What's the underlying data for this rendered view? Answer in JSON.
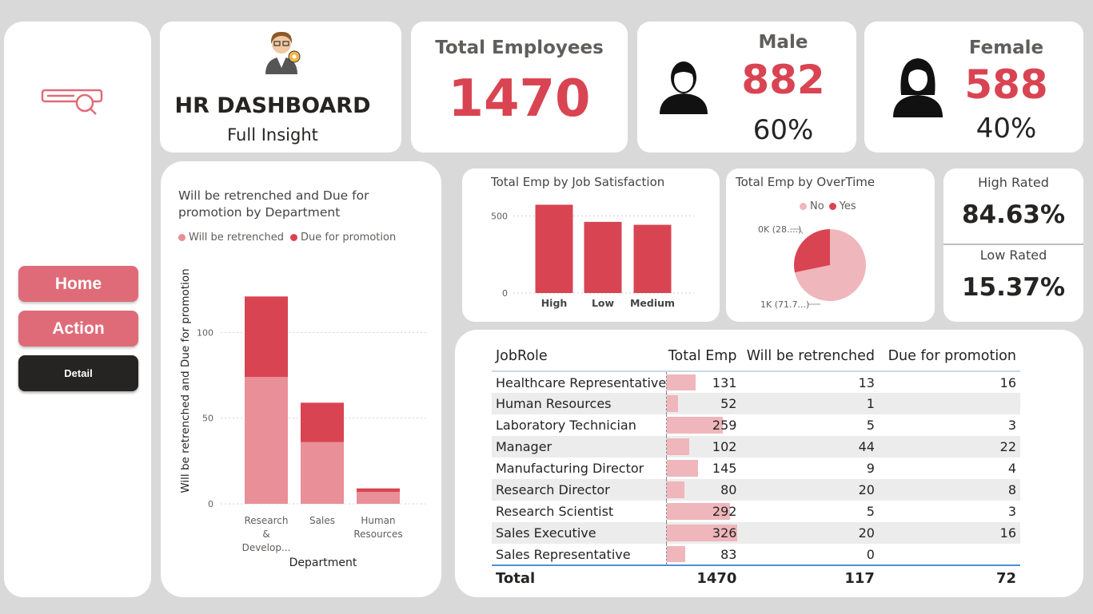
{
  "nav": {
    "home": "Home",
    "action": "Action",
    "detail": "Detail"
  },
  "header": {
    "title": "HR DASHBOARD",
    "subtitle": "Full Insight"
  },
  "kpis": {
    "total_label": "Total Employees",
    "total_value": "1470",
    "male_label": "Male",
    "male_value": "882",
    "male_pct": "60%",
    "female_label": "Female",
    "female_value": "588",
    "female_pct": "40%",
    "high_label": "High Rated",
    "high_value": "84.63%",
    "low_label": "Low Rated",
    "low_value": "15.37%"
  },
  "colors": {
    "accent": "#d94452",
    "light_accent": "#e88f98",
    "pie_light": "#efb6bb"
  },
  "dept_chart": {
    "title": "Will be retrenched and Due for promotion by Department",
    "legend": [
      "Will be retrenched",
      "Due for promotion"
    ],
    "ylabel": "Will be retrenched and Due for promotion",
    "xlabel": "Department"
  },
  "job_sat_chart": {
    "title": "Total Emp by Job Satisfaction"
  },
  "overtime_chart": {
    "title": "Total Emp by OverTime",
    "legend": [
      "No",
      "Yes"
    ],
    "label_yes": "0K (28....)",
    "label_no": "1K (71.7...)"
  },
  "chart_data": [
    {
      "type": "bar",
      "stacked": true,
      "categories": [
        "Research & Develop...",
        "Sales",
        "Human Resources"
      ],
      "series": [
        {
          "name": "Will be retrenched",
          "values": [
            74,
            36,
            7
          ],
          "color": "#e88f98"
        },
        {
          "name": "Due for promotion",
          "values": [
            47,
            23,
            2
          ],
          "color": "#d94452"
        }
      ],
      "yticks": [
        0,
        50,
        100
      ],
      "ylim": [
        0,
        130
      ]
    },
    {
      "type": "bar",
      "categories": [
        "High",
        "Low",
        "Medium"
      ],
      "values": [
        572,
        461,
        442
      ],
      "yticks": [
        0,
        500
      ],
      "ylim": [
        0,
        600
      ],
      "color": "#d94452"
    },
    {
      "type": "pie",
      "labels": [
        "No",
        "Yes"
      ],
      "values": [
        1054,
        416
      ],
      "colors": [
        "#efb6bb",
        "#d94452"
      ]
    }
  ],
  "table": {
    "headers": [
      "JobRole",
      "Total Emp",
      "Will be retrenched",
      "Due for promotion"
    ],
    "rows": [
      [
        "Healthcare Representative",
        "131",
        "13",
        "16"
      ],
      [
        "Human Resources",
        "52",
        "1",
        ""
      ],
      [
        "Laboratory Technician",
        "259",
        "5",
        "3"
      ],
      [
        "Manager",
        "102",
        "44",
        "22"
      ],
      [
        "Manufacturing Director",
        "145",
        "9",
        "4"
      ],
      [
        "Research Director",
        "80",
        "20",
        "8"
      ],
      [
        "Research Scientist",
        "292",
        "5",
        "3"
      ],
      [
        "Sales Executive",
        "326",
        "20",
        "16"
      ],
      [
        "Sales Representative",
        "83",
        "0",
        ""
      ]
    ],
    "total": [
      "Total",
      "1470",
      "117",
      "72"
    ],
    "bar_max": 326
  }
}
